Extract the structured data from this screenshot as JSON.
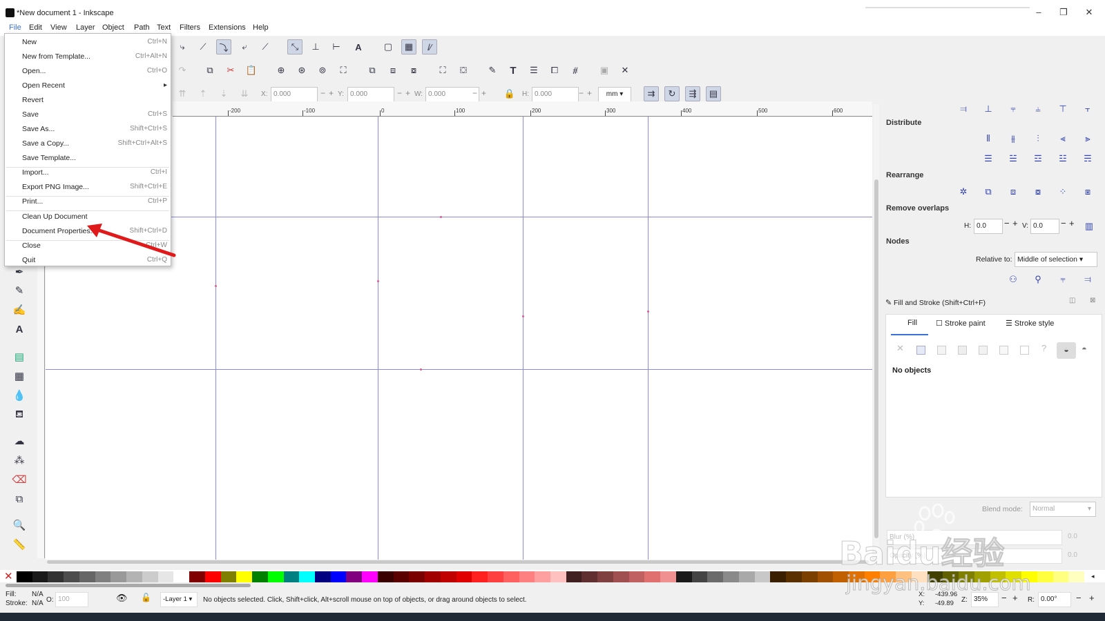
{
  "window": {
    "title": "*New document 1 - Inkscape",
    "min": "–",
    "max": "❐",
    "close": "✕"
  },
  "menubar": [
    "File",
    "Edit",
    "View",
    "Layer",
    "Object",
    "Path",
    "Text",
    "Filters",
    "Extensions",
    "Help"
  ],
  "file_menu": [
    {
      "label": "New",
      "shortcut": "Ctrl+N"
    },
    {
      "label": "New from Template...",
      "shortcut": "Ctrl+Alt+N"
    },
    {
      "label": "Open...",
      "shortcut": "Ctrl+O"
    },
    {
      "label": "Open Recent",
      "shortcut": "▸"
    },
    {
      "label": "Revert",
      "shortcut": ""
    },
    {
      "label": "Save",
      "shortcut": "Ctrl+S"
    },
    {
      "label": "Save As...",
      "shortcut": "Shift+Ctrl+S"
    },
    {
      "label": "Save a Copy...",
      "shortcut": "Shift+Ctrl+Alt+S"
    },
    {
      "label": "Save Template...",
      "shortcut": ""
    },
    {
      "label": "Import...",
      "shortcut": "Ctrl+I"
    },
    {
      "label": "Export PNG Image...",
      "shortcut": "Shift+Ctrl+E"
    },
    {
      "label": "Print...",
      "shortcut": "Ctrl+P"
    },
    {
      "label": "Clean Up Document",
      "shortcut": ""
    },
    {
      "label": "Document Properties...",
      "shortcut": "Shift+Ctrl+D"
    },
    {
      "label": "Close",
      "shortcut": "Ctrl+W"
    },
    {
      "label": "Quit",
      "shortcut": "Ctrl+Q"
    }
  ],
  "coords": {
    "x_label": "X:",
    "x": "0.000",
    "y_label": "Y:",
    "y": "0.000",
    "w_label": "W:",
    "w": "0.000",
    "h_label": "H:",
    "h": "0.000",
    "unit": "mm ▾"
  },
  "ruler": {
    "ticks": [
      "-200",
      "-100",
      "0",
      "100",
      "200",
      "300",
      "400",
      "500",
      "600"
    ]
  },
  "dock": {
    "distribute": "Distribute",
    "rearrange": "Rearrange",
    "remove_overlaps": "Remove overlaps",
    "h_label": "H:",
    "h_val": "0.0",
    "v_label": "V:",
    "v_val": "0.0",
    "nodes": "Nodes",
    "relative_to": "Relative to:",
    "relative_value": "Middle of selection"
  },
  "fill_stroke": {
    "title": "Fill and Stroke (Shift+Ctrl+F)",
    "tabs": [
      "Fill",
      "Stroke paint",
      "Stroke style"
    ],
    "no_objects": "No objects",
    "blend_label": "Blend mode:",
    "blend_value": "Normal",
    "blur_label": "Blur (%)",
    "blur_val": "0.0",
    "opacity_label": "Opacity (%)",
    "opacity_val": "0.0"
  },
  "status": {
    "fill_label": "Fill:",
    "fill_val": "N/A",
    "stroke_label": "Stroke:",
    "stroke_val": "N/A",
    "o_label": "O:",
    "o_val": "100",
    "layer": "-Layer 1 ▾",
    "message": "No objects selected. Click, Shift+click, Alt+scroll mouse on top of objects, or drag around objects to select.",
    "x_label": "X:",
    "x_val": "-439.96",
    "y_label": "Y:",
    "y_val": "-49.89",
    "z_label": "Z:",
    "zoom": "35%",
    "r_label": "R:",
    "rotation": "0.00°"
  },
  "watermark": {
    "text1": "Baidu经验",
    "text2": "jingyan.baidu.com"
  },
  "colors": {
    "accent": "#3b6fd8",
    "guide": "#8a8ae0",
    "arrow": "#e01a1a"
  }
}
